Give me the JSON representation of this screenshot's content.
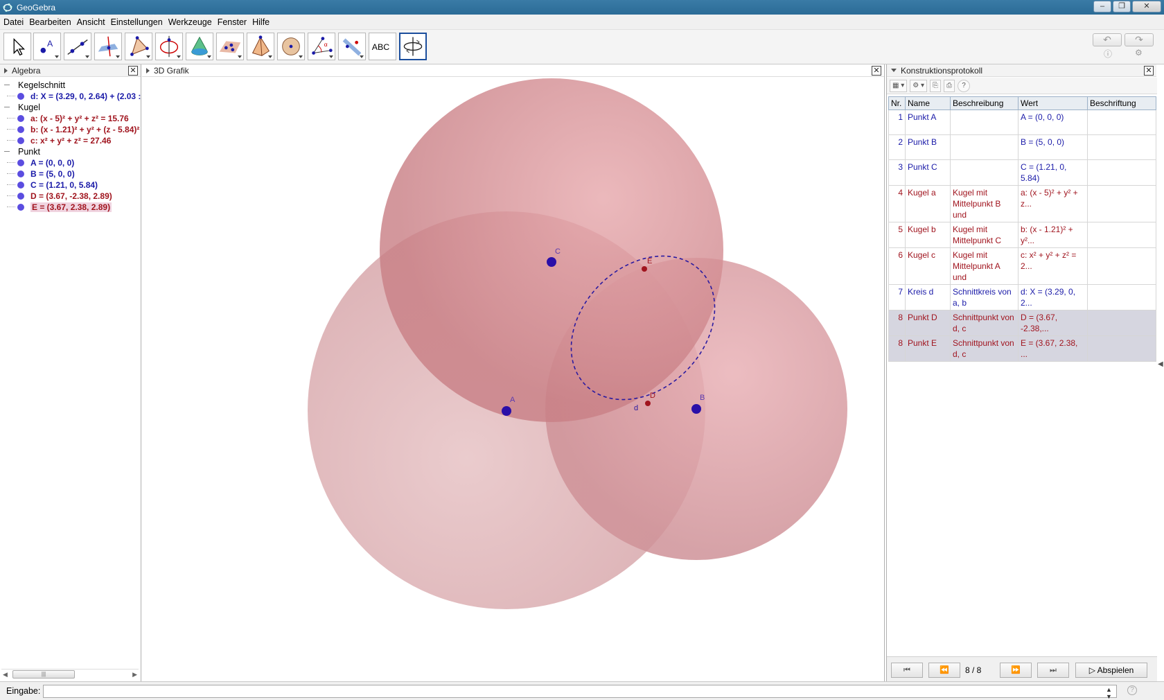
{
  "window": {
    "title": "GeoGebra"
  },
  "menu": [
    "Datei",
    "Bearbeiten",
    "Ansicht",
    "Einstellungen",
    "Werkzeuge",
    "Fenster",
    "Hilfe"
  ],
  "toolbar": {
    "tools": [
      "move-tool",
      "point-tool",
      "line-tool",
      "perpendicular-tool",
      "polygon-tool",
      "circle-tool",
      "cone-tool",
      "plane-tool",
      "pyramid-tool",
      "sphere-tool",
      "angle-tool",
      "reflect-tool",
      "text-tool",
      "rotate-view-tool"
    ],
    "text_tool_label": "ABC",
    "undo": "↶",
    "redo": "↷"
  },
  "algebra": {
    "title": "Algebra",
    "groups": [
      {
        "label": "Kegelschnitt",
        "items": [
          {
            "text": "d: X = (3.29, 0, 2.64) + (2.03 :",
            "color": "#1a1aa8"
          }
        ]
      },
      {
        "label": "Kugel",
        "items": [
          {
            "text": "a: (x - 5)² + y² + z² = 15.76",
            "color": "#a0141e"
          },
          {
            "text": "b: (x - 1.21)² + y² + (z - 5.84)²",
            "color": "#a0141e"
          },
          {
            "text": "c: x² + y² + z² = 27.46",
            "color": "#a0141e"
          }
        ]
      },
      {
        "label": "Punkt",
        "items": [
          {
            "text": "A = (0, 0, 0)",
            "color": "#1a1aa8"
          },
          {
            "text": "B = (5, 0, 0)",
            "color": "#1a1aa8"
          },
          {
            "text": "C = (1.21, 0, 5.84)",
            "color": "#1a1aa8"
          },
          {
            "text": "D = (3.67, -2.38, 2.89)",
            "color": "#a0141e"
          },
          {
            "text": "E = (3.67, 2.38, 2.89)",
            "color": "#a0141e",
            "highlighted": true
          }
        ]
      }
    ]
  },
  "graphics": {
    "title": "3D Grafik",
    "labels": {
      "A": "A",
      "B": "B",
      "C": "C",
      "D": "D",
      "E": "E",
      "d": "d"
    }
  },
  "protocol": {
    "title": "Konstruktionsprotokoll",
    "columns": [
      "Nr.",
      "Name",
      "Beschreibung",
      "Wert",
      "Beschriftung"
    ],
    "rows": [
      {
        "nr": "1",
        "name": "Punkt A",
        "desc": "",
        "value": "A = (0, 0, 0)",
        "caption": "",
        "color": "blue"
      },
      {
        "nr": "2",
        "name": "Punkt B",
        "desc": "",
        "value": "B = (5, 0, 0)",
        "caption": "",
        "color": "blue"
      },
      {
        "nr": "3",
        "name": "Punkt C",
        "desc": "",
        "value": "C = (1.21, 0, 5.84)",
        "caption": "",
        "color": "blue"
      },
      {
        "nr": "4",
        "name": "Kugel a",
        "desc": "Kugel mit Mittelpunkt B und",
        "value": "a: (x - 5)² + y² + z...",
        "caption": "",
        "color": "red"
      },
      {
        "nr": "5",
        "name": "Kugel b",
        "desc": "Kugel mit Mittelpunkt C",
        "value": "b: (x - 1.21)² + y²...",
        "caption": "",
        "color": "red"
      },
      {
        "nr": "6",
        "name": "Kugel c",
        "desc": "Kugel mit Mittelpunkt A und",
        "value": "c: x² + y² + z² = 2...",
        "caption": "",
        "color": "red"
      },
      {
        "nr": "7",
        "name": "Kreis d",
        "desc": "Schnittkreis von a, b",
        "value": "d: X = (3.29, 0, 2...",
        "caption": "",
        "color": "blue"
      },
      {
        "nr": "8",
        "name": "Punkt D",
        "desc": "Schnittpunkt von d, c",
        "value": "D = (3.67, -2.38,...",
        "caption": "",
        "color": "red",
        "selected": true
      },
      {
        "nr": "8",
        "name": "Punkt E",
        "desc": "Schnittpunkt von d, c",
        "value": "E = (3.67, 2.38, ...",
        "caption": "",
        "color": "red",
        "selected": true
      }
    ],
    "navigation": {
      "counter": "8 / 8",
      "play_label": "Abspielen"
    }
  },
  "input": {
    "label": "Eingabe:",
    "value": "",
    "placeholder": ""
  },
  "colors": {
    "sphere": "#c97a80",
    "point_blue": "#2a0fa8",
    "point_red": "#a0141e",
    "circle": "#2a1aa0"
  }
}
